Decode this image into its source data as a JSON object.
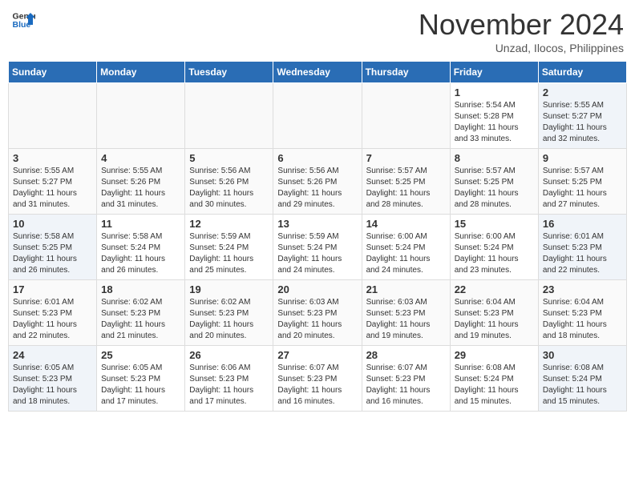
{
  "logo": {
    "general": "General",
    "blue": "Blue"
  },
  "header": {
    "month": "November 2024",
    "location": "Unzad, Ilocos, Philippines"
  },
  "weekdays": [
    "Sunday",
    "Monday",
    "Tuesday",
    "Wednesday",
    "Thursday",
    "Friday",
    "Saturday"
  ],
  "weeks": [
    [
      {
        "day": "",
        "info": ""
      },
      {
        "day": "",
        "info": ""
      },
      {
        "day": "",
        "info": ""
      },
      {
        "day": "",
        "info": ""
      },
      {
        "day": "",
        "info": ""
      },
      {
        "day": "1",
        "info": "Sunrise: 5:54 AM\nSunset: 5:28 PM\nDaylight: 11 hours and 33 minutes."
      },
      {
        "day": "2",
        "info": "Sunrise: 5:55 AM\nSunset: 5:27 PM\nDaylight: 11 hours and 32 minutes."
      }
    ],
    [
      {
        "day": "3",
        "info": "Sunrise: 5:55 AM\nSunset: 5:27 PM\nDaylight: 11 hours and 31 minutes."
      },
      {
        "day": "4",
        "info": "Sunrise: 5:55 AM\nSunset: 5:26 PM\nDaylight: 11 hours and 31 minutes."
      },
      {
        "day": "5",
        "info": "Sunrise: 5:56 AM\nSunset: 5:26 PM\nDaylight: 11 hours and 30 minutes."
      },
      {
        "day": "6",
        "info": "Sunrise: 5:56 AM\nSunset: 5:26 PM\nDaylight: 11 hours and 29 minutes."
      },
      {
        "day": "7",
        "info": "Sunrise: 5:57 AM\nSunset: 5:25 PM\nDaylight: 11 hours and 28 minutes."
      },
      {
        "day": "8",
        "info": "Sunrise: 5:57 AM\nSunset: 5:25 PM\nDaylight: 11 hours and 28 minutes."
      },
      {
        "day": "9",
        "info": "Sunrise: 5:57 AM\nSunset: 5:25 PM\nDaylight: 11 hours and 27 minutes."
      }
    ],
    [
      {
        "day": "10",
        "info": "Sunrise: 5:58 AM\nSunset: 5:25 PM\nDaylight: 11 hours and 26 minutes."
      },
      {
        "day": "11",
        "info": "Sunrise: 5:58 AM\nSunset: 5:24 PM\nDaylight: 11 hours and 26 minutes."
      },
      {
        "day": "12",
        "info": "Sunrise: 5:59 AM\nSunset: 5:24 PM\nDaylight: 11 hours and 25 minutes."
      },
      {
        "day": "13",
        "info": "Sunrise: 5:59 AM\nSunset: 5:24 PM\nDaylight: 11 hours and 24 minutes."
      },
      {
        "day": "14",
        "info": "Sunrise: 6:00 AM\nSunset: 5:24 PM\nDaylight: 11 hours and 24 minutes."
      },
      {
        "day": "15",
        "info": "Sunrise: 6:00 AM\nSunset: 5:24 PM\nDaylight: 11 hours and 23 minutes."
      },
      {
        "day": "16",
        "info": "Sunrise: 6:01 AM\nSunset: 5:23 PM\nDaylight: 11 hours and 22 minutes."
      }
    ],
    [
      {
        "day": "17",
        "info": "Sunrise: 6:01 AM\nSunset: 5:23 PM\nDaylight: 11 hours and 22 minutes."
      },
      {
        "day": "18",
        "info": "Sunrise: 6:02 AM\nSunset: 5:23 PM\nDaylight: 11 hours and 21 minutes."
      },
      {
        "day": "19",
        "info": "Sunrise: 6:02 AM\nSunset: 5:23 PM\nDaylight: 11 hours and 20 minutes."
      },
      {
        "day": "20",
        "info": "Sunrise: 6:03 AM\nSunset: 5:23 PM\nDaylight: 11 hours and 20 minutes."
      },
      {
        "day": "21",
        "info": "Sunrise: 6:03 AM\nSunset: 5:23 PM\nDaylight: 11 hours and 19 minutes."
      },
      {
        "day": "22",
        "info": "Sunrise: 6:04 AM\nSunset: 5:23 PM\nDaylight: 11 hours and 19 minutes."
      },
      {
        "day": "23",
        "info": "Sunrise: 6:04 AM\nSunset: 5:23 PM\nDaylight: 11 hours and 18 minutes."
      }
    ],
    [
      {
        "day": "24",
        "info": "Sunrise: 6:05 AM\nSunset: 5:23 PM\nDaylight: 11 hours and 18 minutes."
      },
      {
        "day": "25",
        "info": "Sunrise: 6:05 AM\nSunset: 5:23 PM\nDaylight: 11 hours and 17 minutes."
      },
      {
        "day": "26",
        "info": "Sunrise: 6:06 AM\nSunset: 5:23 PM\nDaylight: 11 hours and 17 minutes."
      },
      {
        "day": "27",
        "info": "Sunrise: 6:07 AM\nSunset: 5:23 PM\nDaylight: 11 hours and 16 minutes."
      },
      {
        "day": "28",
        "info": "Sunrise: 6:07 AM\nSunset: 5:23 PM\nDaylight: 11 hours and 16 minutes."
      },
      {
        "day": "29",
        "info": "Sunrise: 6:08 AM\nSunset: 5:24 PM\nDaylight: 11 hours and 15 minutes."
      },
      {
        "day": "30",
        "info": "Sunrise: 6:08 AM\nSunset: 5:24 PM\nDaylight: 11 hours and 15 minutes."
      }
    ]
  ]
}
